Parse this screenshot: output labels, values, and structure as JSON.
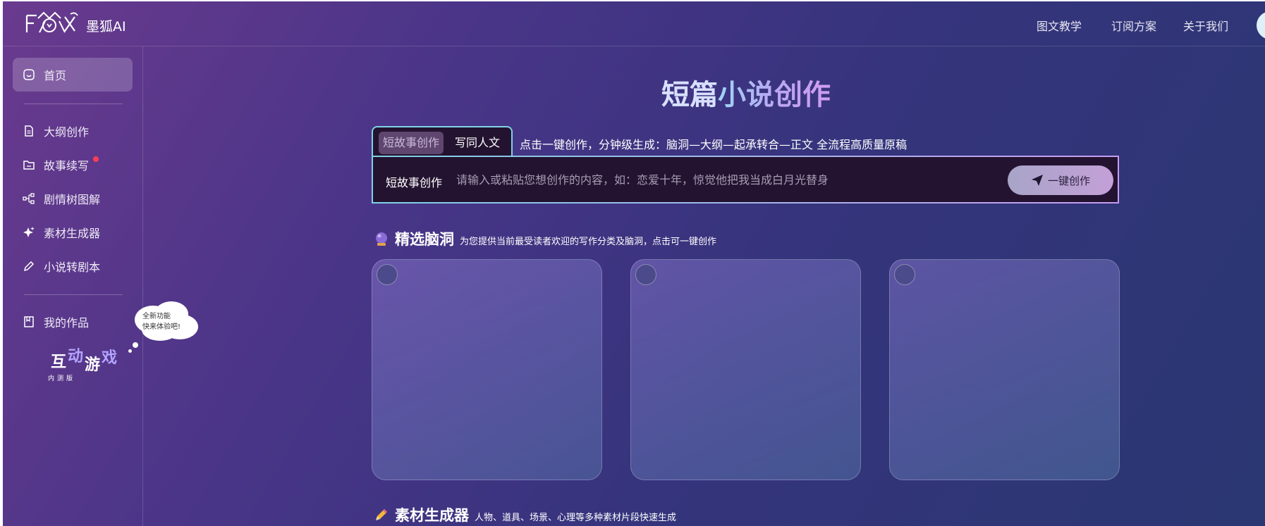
{
  "header": {
    "brand": "墨狐AI",
    "nav": [
      "图文教学",
      "订阅方案",
      "关于我们"
    ]
  },
  "sidebar": {
    "items": [
      {
        "label": "首页",
        "icon": "home-icon",
        "active": true
      },
      {
        "label": "大纲创作",
        "icon": "document-icon"
      },
      {
        "label": "故事续写",
        "icon": "folder-icon",
        "badge": true
      },
      {
        "label": "剧情树图解",
        "icon": "tree-icon"
      },
      {
        "label": "素材生成器",
        "icon": "sparkle-icon"
      },
      {
        "label": "小说转剧本",
        "icon": "pencil-icon"
      },
      {
        "label": "我的作品",
        "icon": "bookmark-icon"
      }
    ],
    "bubble": [
      "全新功能",
      "快来体验吧!"
    ],
    "game": {
      "chars": [
        "互",
        "动",
        "游",
        "戏"
      ],
      "sub": "内测版"
    }
  },
  "main": {
    "title_part1": "短篇",
    "title_part2": "小说创作",
    "tabs": [
      "短故事创作",
      "写同人文"
    ],
    "tab_desc": "点击一键创作，分钟级生成：脑洞—大纲—起承转合—正文 全流程高质量原稿",
    "input_label": "短故事创作",
    "input_placeholder": "请输入或粘贴您想创作的内容，如：恋爱十年，惊觉他把我当成白月光替身",
    "generate_button": "一键创作",
    "section1_title": "精选脑洞",
    "section1_sub": "为您提供当前最受读者欢迎的写作分类及脑洞，点击可一键创作",
    "section2_title": "素材生成器",
    "section2_sub": "人物、道具、场景、心理等多种素材片段快速生成"
  },
  "colors": {
    "accent_cyan": "#7fd2e6",
    "accent_purple": "#c79bf0",
    "badge_red": "#ff3d57"
  }
}
